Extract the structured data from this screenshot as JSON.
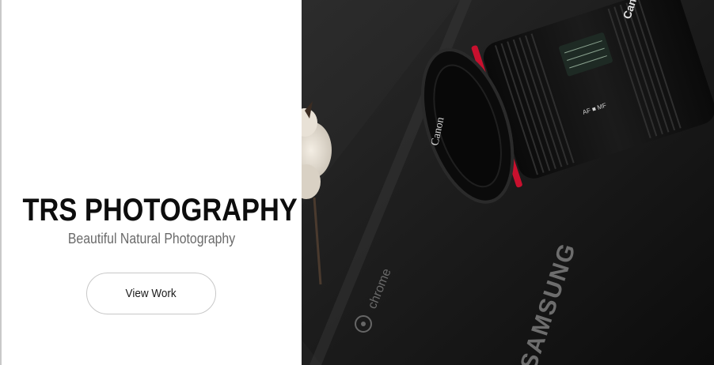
{
  "hero": {
    "title": "TRS PHOTOGRAPHY",
    "tagline": "Beautiful Natural Photography",
    "cta_label": "View Work"
  },
  "photo": {
    "laptop_brand": "SAMSUNG",
    "laptop_os": "chrome",
    "lens_brand": "Canon",
    "lens_markings": "AF ■ MF",
    "camera_brand": "Canon"
  },
  "colors": {
    "title": "#0d0d0d",
    "tagline": "#6a6a6a",
    "button_border": "#c8c8c8",
    "photo_bg": "#1f1f1f",
    "lens_red_ring": "#c8102e"
  }
}
